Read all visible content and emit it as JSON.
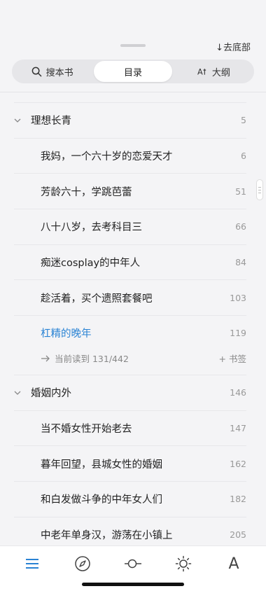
{
  "header": {
    "to_bottom_label": "↓去底部"
  },
  "tabs": [
    {
      "label": "搜本书",
      "icon": "search-icon"
    },
    {
      "label": "目录",
      "active": true
    },
    {
      "label": "大纲",
      "icon": "outline-icon",
      "prefix": "A†"
    }
  ],
  "toc": {
    "sections": [
      {
        "title": "理想长青",
        "num": "5",
        "chapters": [
          {
            "title": "我妈，一个六十岁的恋爱天才",
            "num": "6"
          },
          {
            "title": "芳龄六十，学跳芭蕾",
            "num": "51"
          },
          {
            "title": "八十八岁，去考科目三",
            "num": "66"
          },
          {
            "title": "痴迷cosplay的中年人",
            "num": "84"
          },
          {
            "title": "趁活着，买个遗照套餐吧",
            "num": "103"
          },
          {
            "title": "杠精的晚年",
            "num": "119",
            "current": true
          }
        ]
      },
      {
        "title": "婚姻内外",
        "num": "146",
        "chapters": [
          {
            "title": "当不婚女性开始老去",
            "num": "147"
          },
          {
            "title": "暮年回望，县城女性的婚姻",
            "num": "162"
          },
          {
            "title": "和白发做斗争的中年女人们",
            "num": "182"
          },
          {
            "title": "中老年单身汉，游荡在小镇上",
            "num": "205"
          }
        ]
      }
    ],
    "progress_text": "当前读到 131/442",
    "bookmark_label": "+ 书签"
  },
  "colors": {
    "accent": "#2a83d4",
    "background": "#f4f4f6"
  },
  "bottom_nav": [
    {
      "icon": "menu-icon",
      "active": true
    },
    {
      "icon": "compass-icon"
    },
    {
      "icon": "progress-slider-icon"
    },
    {
      "icon": "brightness-icon"
    },
    {
      "icon": "font-icon",
      "glyph": "A"
    }
  ]
}
